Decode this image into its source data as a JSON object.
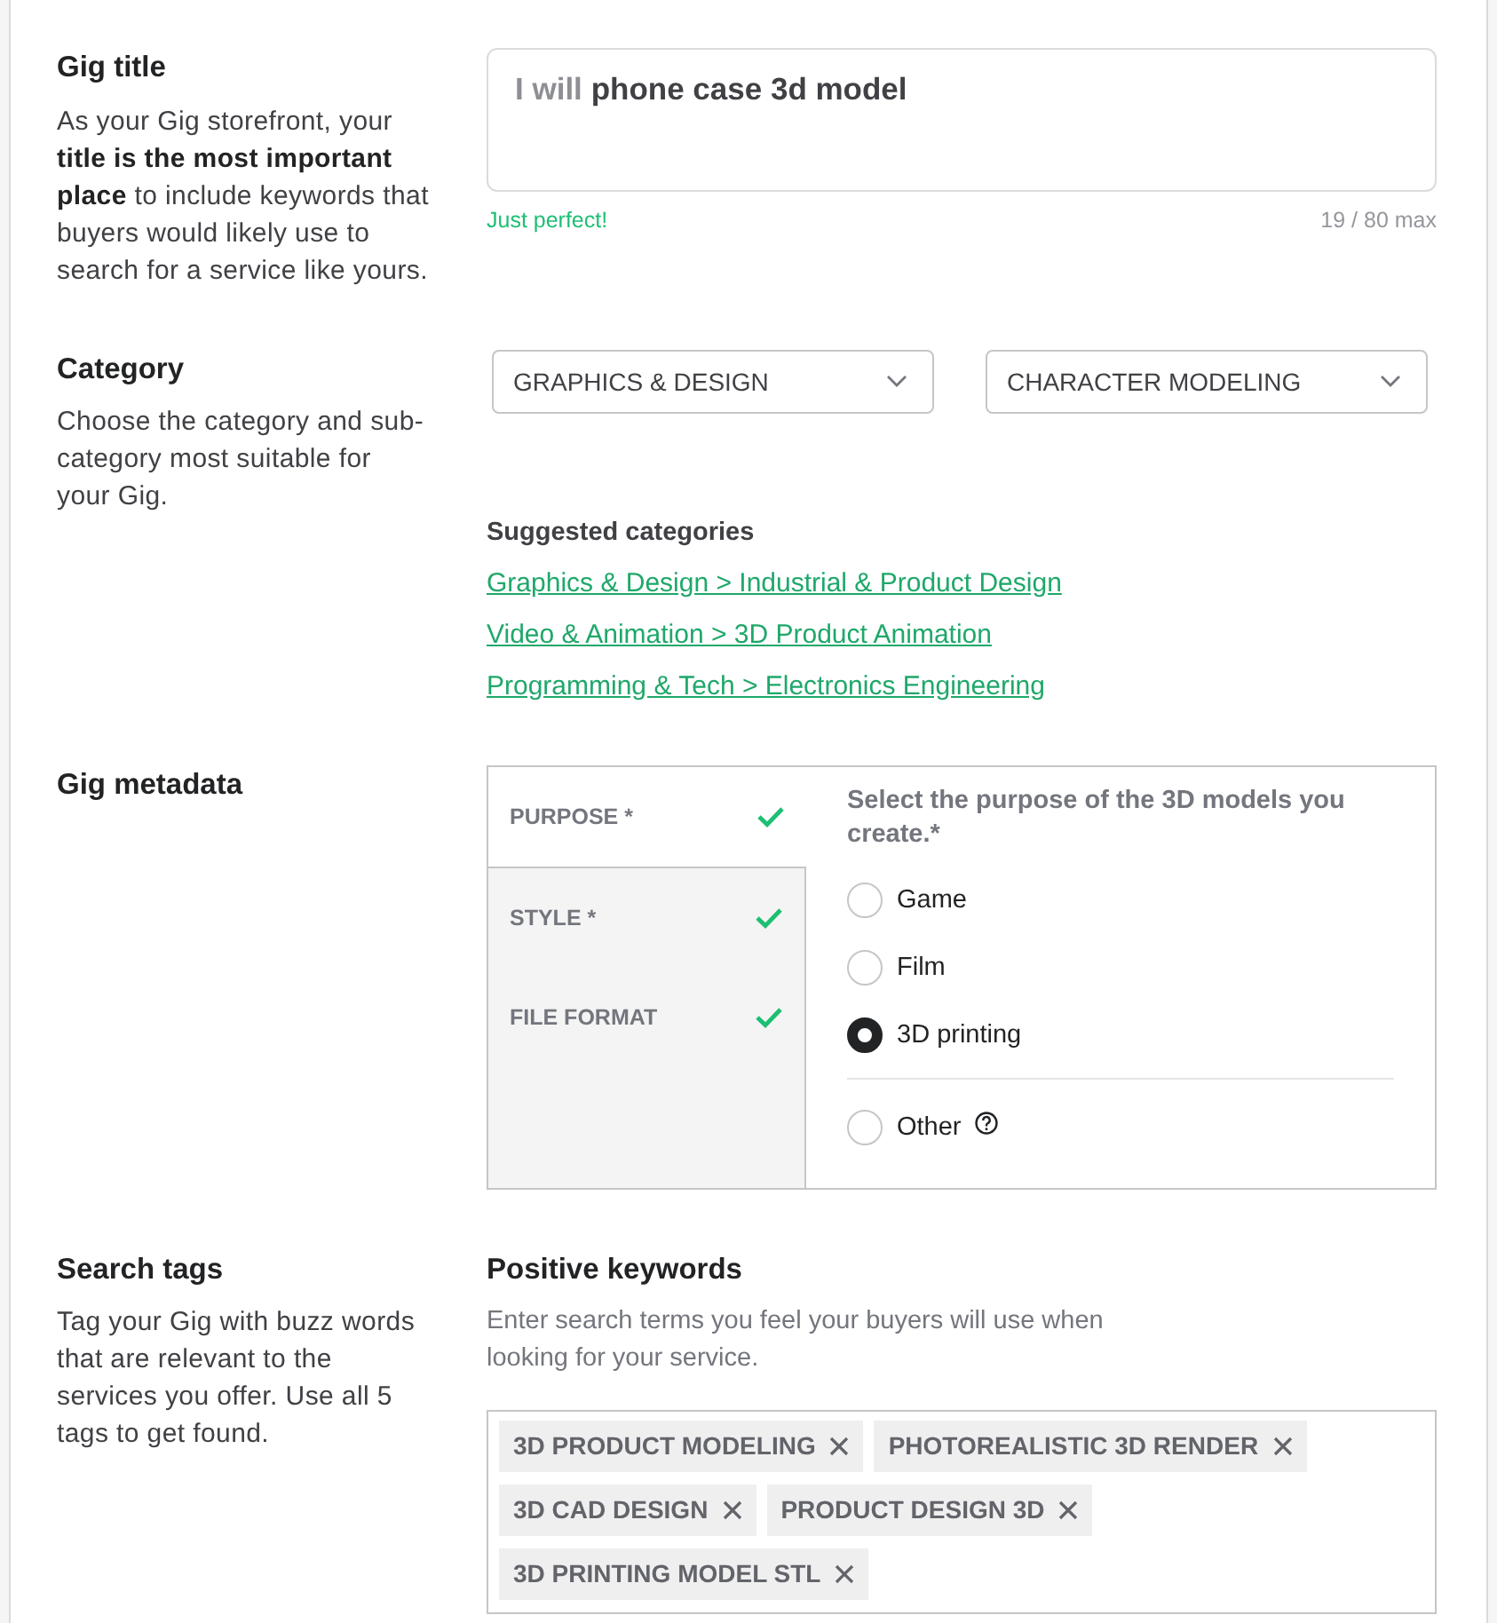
{
  "gig_title": {
    "heading": "Gig title",
    "description": "As your Gig storefront, your **title is the most important place** to include keywords that buyers would likely use to search for a service like yours.",
    "title_field": {
      "prefix": "I will",
      "value": "phone case 3d model"
    },
    "status": "Just perfect!",
    "counter": "19 / 80 max"
  },
  "category": {
    "heading": "Category",
    "description": "Choose the category and sub-category most suitable for your Gig.",
    "dropdowns": [
      {
        "value": "GRAPHICS & DESIGN"
      },
      {
        "value": "CHARACTER MODELING"
      }
    ],
    "suggested": {
      "heading": "Suggested categories",
      "links": [
        "Graphics & Design > Industrial & Product Design",
        "Video & Animation > 3D Product Animation",
        "Programming & Tech > Electronics Engineering"
      ]
    }
  },
  "gig_metadata": {
    "heading": "Gig metadata",
    "tabs": [
      {
        "label": "PURPOSE *",
        "selected": true,
        "complete": true
      },
      {
        "label": "STYLE *",
        "selected": false,
        "complete": true
      },
      {
        "label": "FILE FORMAT",
        "selected": false,
        "complete": true
      }
    ],
    "question": "Select the purpose of the 3D models you create.*",
    "options": [
      {
        "kind": "option",
        "label": "Game",
        "selected": false
      },
      {
        "kind": "option",
        "label": "Film",
        "selected": false
      },
      {
        "kind": "option",
        "label": "3D printing",
        "selected": true
      },
      {
        "kind": "other",
        "label": "Other",
        "selected": false
      }
    ]
  },
  "search_tags": {
    "heading": "Search tags",
    "description": "Tag your Gig with buzz words that are relevant to the services you offer. Use all 5 tags to get found.",
    "keywords": {
      "heading": "Positive keywords",
      "hint": "Enter search terms you feel your buyers will use when looking for your service.",
      "tags": [
        "3D PRODUCT MODELING",
        "PHOTOREALISTIC 3D RENDER",
        "3D CAD DESIGN",
        "PRODUCT DESIGN 3D",
        "3D PRINTING MODEL STL"
      ]
    }
  }
}
